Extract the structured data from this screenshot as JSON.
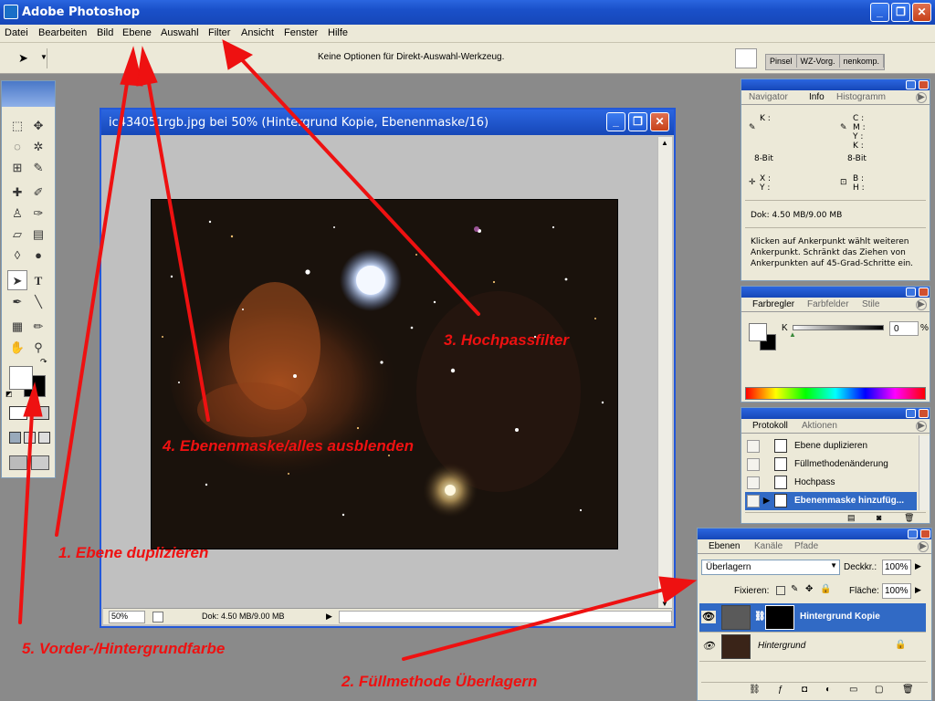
{
  "app": {
    "title": "Adobe Photoshop",
    "window_buttons": [
      "_",
      "❐",
      "✕"
    ]
  },
  "menu": [
    "Datei",
    "Bearbeiten",
    "Bild",
    "Ebene",
    "Auswahl",
    "Filter",
    "Ansicht",
    "Fenster",
    "Hilfe"
  ],
  "options_bar": {
    "message": "Keine Optionen für Direkt-Auswahl-Werkzeug.",
    "palette_well_tabs": [
      "Pinsel",
      "WZ-Vorg.",
      "nenkomp."
    ]
  },
  "document": {
    "title": "ic434051rgb.jpg bei 50% (Hintergrund Kopie, Ebenenmaske/16)",
    "zoom": "50%",
    "doc_size": "Dok: 4.50 MB/9.00 MB"
  },
  "info_panel": {
    "tabs": [
      "Navigator",
      "Info",
      "Histogramm"
    ],
    "active_tab": "Info",
    "left_k": "K :",
    "right_cmyk": [
      "C :",
      "M :",
      "Y :",
      "K :"
    ],
    "bit_left": "8-Bit",
    "bit_right": "8-Bit",
    "xy": [
      "X :",
      "Y :"
    ],
    "bh": [
      "B :",
      "H :"
    ],
    "doc": "Dok: 4.50 MB/9.00 MB",
    "hint": "Klicken auf Ankerpunkt wählt weiteren Ankerpunkt. Schränkt das Ziehen von Ankerpunkten auf 45-Grad-Schritte ein."
  },
  "color_panel": {
    "tabs": [
      "Farbregler",
      "Farbfelder",
      "Stile"
    ],
    "active_tab": "Farbregler",
    "channel": "K",
    "value": "0",
    "unit": "%"
  },
  "history_panel": {
    "tabs": [
      "Protokoll",
      "Aktionen"
    ],
    "active_tab": "Protokoll",
    "items": [
      {
        "label": "Ebene duplizieren",
        "selected": false
      },
      {
        "label": "Füllmethodenänderung",
        "selected": false
      },
      {
        "label": "Hochpass",
        "selected": false
      },
      {
        "label": "Ebenenmaske hinzufüg...",
        "selected": true
      }
    ]
  },
  "layers_panel": {
    "tabs": [
      "Ebenen",
      "Kanäle",
      "Pfade"
    ],
    "active_tab": "Ebenen",
    "blend_mode": "Überlagern",
    "opacity_label": "Deckkr.:",
    "opacity": "100%",
    "lock_label": "Fixieren:",
    "fill_label": "Fläche:",
    "fill": "100%",
    "layers": [
      {
        "name": "Hintergrund Kopie",
        "selected": true
      },
      {
        "name": "Hintergrund",
        "selected": false
      }
    ]
  },
  "annotations": [
    "1. Ebene duplizieren",
    "2. Füllmethode Überlagern",
    "3. Hochpassfilter",
    "4. Ebenenmaske/alles ausblenden",
    "5. Vorder-/Hintergrundfarbe"
  ],
  "colors": {
    "xp_blue": "#1a50c9",
    "annotation_red": "#ee1111",
    "selection_blue": "#316ac5"
  }
}
